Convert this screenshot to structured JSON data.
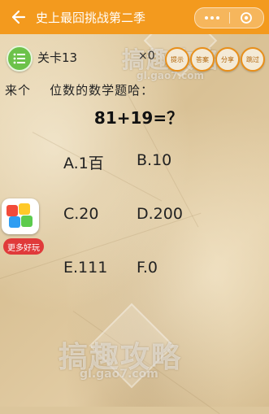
{
  "header": {
    "title": "史上最囧挑战第二季"
  },
  "level_bar": {
    "level_label": "关卡13",
    "multiplier": "×0",
    "buttons": [
      "提示",
      "答案",
      "分享",
      "跳过"
    ]
  },
  "question": {
    "prompt": "来个    位数的数学题哈：",
    "equation": "81+19=？"
  },
  "options": [
    {
      "label": "A.1百"
    },
    {
      "label": "B.10"
    },
    {
      "label": "C.20"
    },
    {
      "label": "D.200"
    },
    {
      "label": "E.111"
    },
    {
      "label": "F.0"
    }
  ],
  "promo": {
    "label": "更多好玩"
  },
  "watermark": {
    "brand": "搞趣攻略",
    "site": "gl.gao7.com"
  },
  "colors": {
    "top_bar": "#f39a1e",
    "list_button": "#6cc24a",
    "promo_label": "#e03a3a"
  }
}
